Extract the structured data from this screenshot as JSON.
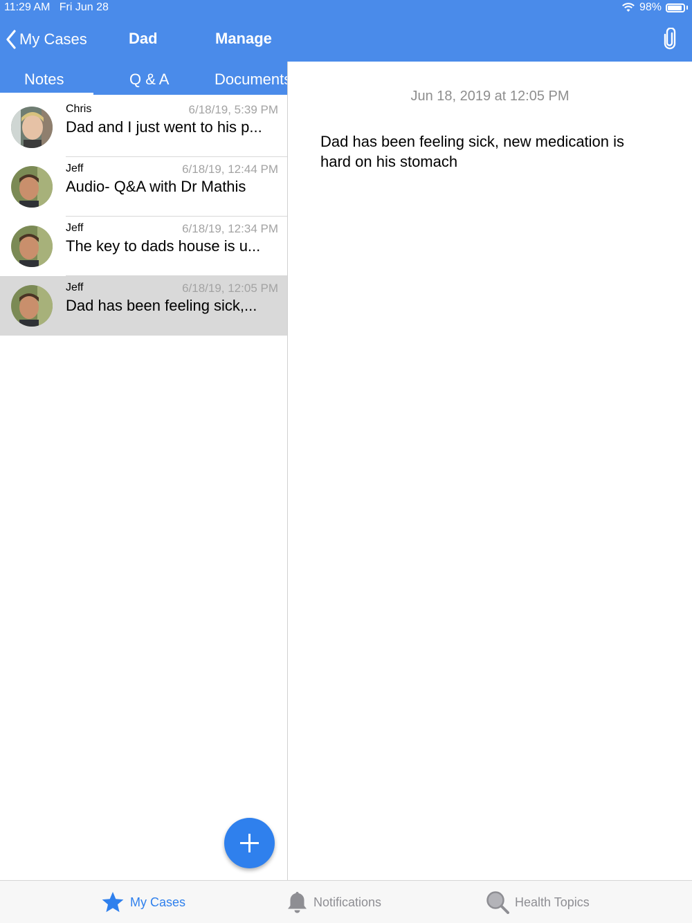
{
  "status": {
    "time": "11:29 AM",
    "date": "Fri Jun 28",
    "battery": "98%",
    "wifi_icon": "wifi-icon",
    "battery_icon": "battery-icon"
  },
  "nav": {
    "back_label": "My Cases",
    "title": "Dad",
    "manage_label": "Manage",
    "attach_icon": "paperclip-icon"
  },
  "tabs": [
    {
      "label": "Notes",
      "selected": true
    },
    {
      "label": "Q & A",
      "selected": false
    },
    {
      "label": "Documents",
      "selected": false
    }
  ],
  "notes": [
    {
      "author": "Chris",
      "time": "6/18/19, 5:39 PM",
      "text": "Dad and I just went to his p...",
      "selected": false
    },
    {
      "author": "Jeff",
      "time": "6/18/19, 12:44 PM",
      "text": "Audio- Q&A with Dr Mathis",
      "selected": false
    },
    {
      "author": "Jeff",
      "time": "6/18/19, 12:34 PM",
      "text": "The key to dads house is u...",
      "selected": false
    },
    {
      "author": "Jeff",
      "time": "6/18/19, 12:05 PM",
      "text": "Dad has been feeling sick,...",
      "selected": true
    }
  ],
  "detail": {
    "date": "Jun 18, 2019 at 12:05 PM",
    "body": "Dad has been feeling sick, new medication is hard on his stomach"
  },
  "fab": {
    "icon": "plus-icon"
  },
  "bottom_tabs": [
    {
      "label": "My Cases",
      "icon": "star-icon",
      "active": true
    },
    {
      "label": "Notifications",
      "icon": "bell-icon",
      "active": false
    },
    {
      "label": "Health Topics",
      "icon": "magnifier-icon",
      "active": false
    }
  ],
  "colors": {
    "brand": "#4a8bea",
    "active_tab": "#2f80ed",
    "inactive_tab": "#8e8e93",
    "selected_row": "#d9d9d9"
  }
}
